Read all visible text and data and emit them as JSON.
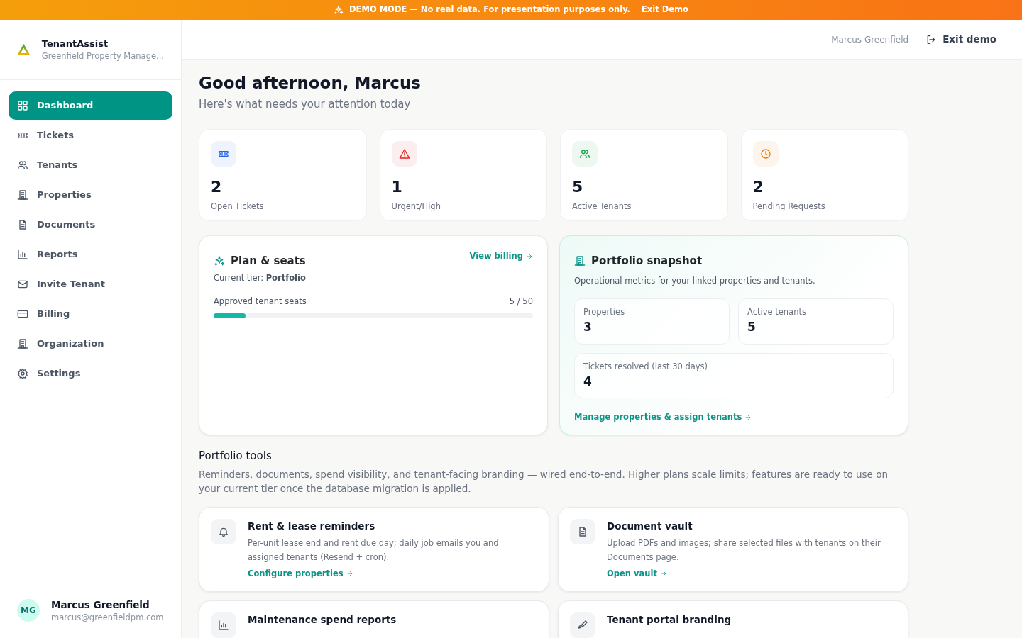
{
  "banner": {
    "text": "DEMO MODE — No real data. For presentation purposes only.",
    "link": "Exit Demo"
  },
  "brand": {
    "name": "TenantAssist",
    "org": "Greenfield Property Manage..."
  },
  "sidebar": {
    "items": [
      {
        "label": "Dashboard",
        "kind": "grid",
        "selected": true
      },
      {
        "label": "Tickets",
        "kind": "ticket",
        "selected": false
      },
      {
        "label": "Tenants",
        "kind": "users",
        "selected": false
      },
      {
        "label": "Properties",
        "kind": "building",
        "selected": false
      },
      {
        "label": "Documents",
        "kind": "doc",
        "selected": false
      },
      {
        "label": "Reports",
        "kind": "chart",
        "selected": false
      },
      {
        "label": "Invite Tenant",
        "kind": "mail",
        "selected": false
      },
      {
        "label": "Billing",
        "kind": "card",
        "selected": false
      },
      {
        "label": "Organization",
        "kind": "building",
        "selected": false
      },
      {
        "label": "Settings",
        "kind": "gear",
        "selected": false
      }
    ]
  },
  "user": {
    "initials": "MG",
    "name": "Marcus Greenfield",
    "email": "marcus@greenfieldpm.com"
  },
  "topbar": {
    "user": "Marcus Greenfield",
    "exit": "Exit demo"
  },
  "greeting": {
    "title": "Good afternoon, Marcus",
    "subtitle": "Here's what needs your attention today"
  },
  "stats": [
    {
      "value": "2",
      "label": "Open Tickets",
      "kind": "ticket",
      "color": "#2563eb"
    },
    {
      "value": "1",
      "label": "Urgent/High",
      "kind": "alert",
      "color": "#dc2626"
    },
    {
      "value": "5",
      "label": "Active Tenants",
      "kind": "users",
      "color": "#16a34a"
    },
    {
      "value": "2",
      "label": "Pending Requests",
      "kind": "clock",
      "color": "#ea7a0c"
    }
  ],
  "plan": {
    "title": "Plan & seats",
    "link": "View billing",
    "tier": "Current tier: **Portfolio**",
    "seats_label": "Approved tenant seats",
    "seats_reading": "5 / 50",
    "level": 0.1
  },
  "snapshot": {
    "title": "Portfolio snapshot",
    "subtitle": "Operational metrics for your linked properties and tenants.",
    "metrics": [
      {
        "label": "Properties",
        "value": "3"
      },
      {
        "label": "Active tenants",
        "value": "5"
      },
      {
        "label": "Tickets resolved (last 30 days)",
        "value": "4"
      }
    ],
    "link": "Manage properties & assign tenants"
  },
  "tools": {
    "title": "Portfolio tools",
    "description": "Reminders, documents, spend visibility, and tenant-facing branding — wired end-to-end. Higher plans scale limits; features are ready to use on your current tier once the database migration is applied.",
    "items": [
      {
        "title": "Rent & lease reminders",
        "kind": "bell",
        "text": "Per-unit lease end and rent due day; daily job emails you and assigned tenants (Resend + cron).",
        "link": "Configure properties"
      },
      {
        "title": "Document vault",
        "kind": "doc",
        "text": "Upload PDFs and images; share selected files with tenants on their Documents page.",
        "link": "Open vault"
      },
      {
        "title": "Maintenance spend reports",
        "kind": "chart"
      },
      {
        "title": "Tenant portal branding",
        "kind": "brush"
      }
    ]
  }
}
